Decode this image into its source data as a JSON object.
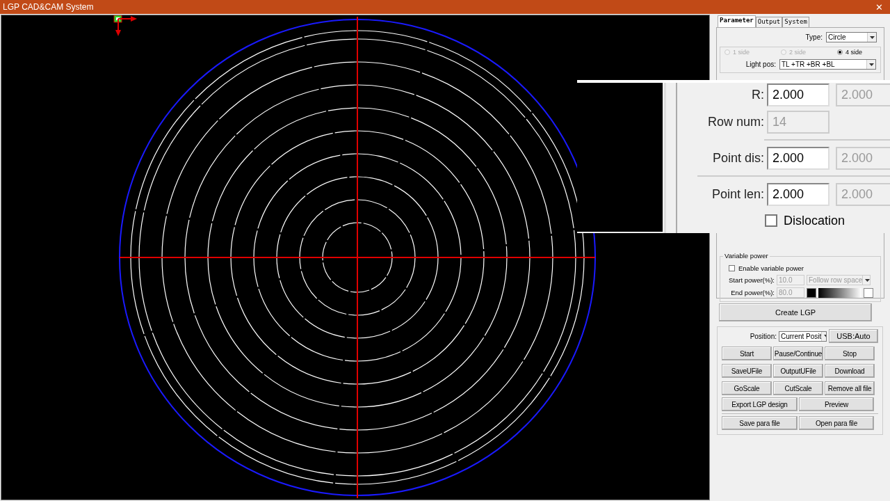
{
  "window": {
    "title": "LGP CAD&CAM System",
    "close": "✕"
  },
  "panel": {
    "tabs": [
      {
        "label": "Parameter",
        "selected": true
      },
      {
        "label": "Output",
        "selected": false
      },
      {
        "label": "System",
        "selected": false
      }
    ],
    "type": {
      "label": "Type:",
      "value": "Circle"
    },
    "sides": [
      {
        "label": "1 side",
        "selected": false,
        "disabled": true
      },
      {
        "label": "2 side",
        "selected": false,
        "disabled": true
      },
      {
        "label": "4 side",
        "selected": true,
        "disabled": false
      }
    ],
    "light_pos": {
      "label": "Light pos:",
      "value": "TL +TR +BR +BL"
    },
    "variable_power": {
      "title": "Variable power",
      "enable": {
        "label": "Enable variable power",
        "checked": false
      },
      "start_label": "Start power(%):",
      "start_value": "10.0",
      "mode": "Follow row space",
      "end_label": "End power(%):",
      "end_value": "80.0"
    },
    "create_button": "Create LGP",
    "position": {
      "label": "Position:",
      "value": "Current Posit",
      "usb": "USB:Auto"
    },
    "buttons": [
      [
        "Start",
        "Pause/Continue",
        "Stop"
      ],
      [
        "SaveUFile",
        "OutputUFile",
        "Download"
      ],
      [
        "GoScale",
        "CutScale",
        "Remove all file"
      ],
      [
        "Export LGP design",
        "Preview"
      ]
    ],
    "file_buttons": [
      "Save para file",
      "Open para file"
    ]
  },
  "magnifier": {
    "rows": [
      {
        "label": "R:",
        "value": "2.000",
        "disabled": false,
        "second": "2.000"
      },
      {
        "label": "Row num:",
        "value": "14",
        "disabled": true
      },
      {
        "label": "Point dis:",
        "value": "2.000",
        "disabled": false,
        "second": "2.000"
      },
      {
        "label": "Point len:",
        "value": "2.000",
        "disabled": false,
        "second": "2.000"
      }
    ],
    "dislocation": {
      "label": "Dislocation",
      "checked": false
    }
  }
}
